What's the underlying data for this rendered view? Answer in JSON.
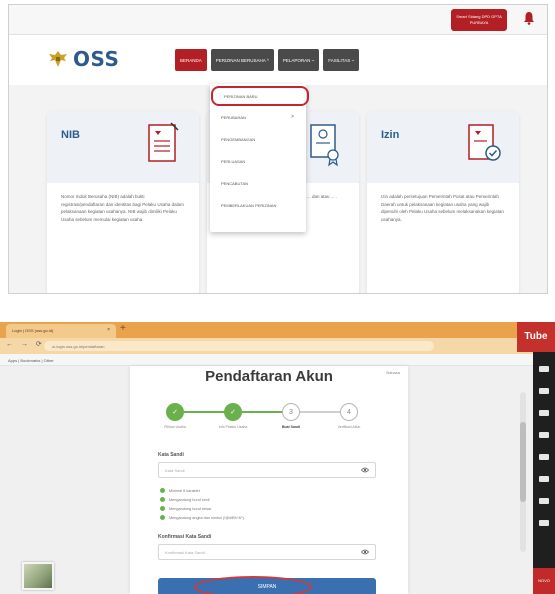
{
  "oss": {
    "user_badge": "Smart Sidang\nDPD GPTA PURBAYA",
    "logo_text": "OSS",
    "nav": [
      "BERANDA",
      "PERIZINAN BERUSAHA ^",
      "PELAPORAN ~",
      "FASILITAS ~"
    ],
    "dropdown": {
      "items": [
        "PERIZINAN BARU",
        "PERUBAHAN",
        "PENGEMBANGAN",
        "PERLUASAN",
        "PENCABUTAN",
        "PEMBERLAKUAN PERIZINAN"
      ],
      "arrow": ">"
    },
    "cards": [
      {
        "title": "NIB",
        "body": "Nomor Induk Berusaha (NIB) adalah bukti registrasi/pendaftaran dan identitas bagi Pelaku Usaha dalam pelaksanaan kegiatan usahanya. NIB wajib dimiliki Pelaku Usaha sebelum memulai kegiatan usaha."
      },
      {
        "title": "",
        "body": "... dan atau ... ."
      },
      {
        "title": "Izin",
        "body": "Izin adalah persetujuan Pemerintah Pusat atau Pemerintah Daerah untuk pelaksanaan kegiatan usaha yang wajib dipenuhi oleh Pelaku Usaha sebelum melaksanakan kegiatan usahanya."
      }
    ]
  },
  "browser": {
    "tab_title": "Login | OSS (oss.go.id)",
    "tab_close": "×",
    "new_tab": "+",
    "nav_arrows": "← → ⟳",
    "address": "ui-login.oss.go.id/pendaftaran",
    "bookmarks": "Apps  |  Bookmarks  |  Other",
    "yt": "Tube",
    "corner": "NOVO"
  },
  "form": {
    "title": "Pendaftaran Akun",
    "lang": "Bahasa",
    "steps": [
      {
        "label": "Pilihan Usaha",
        "state": "done",
        "mark": "✓"
      },
      {
        "label": "Info Pelaku Usaha",
        "state": "done",
        "mark": "✓"
      },
      {
        "label": "Buat Sandi",
        "state": "current",
        "mark": "3"
      },
      {
        "label": "Verifikasi Akun",
        "state": "pending",
        "mark": "4"
      }
    ],
    "password_label": "Kata Sandi",
    "password_placeholder": "Kata Sandi",
    "rules": [
      "Minimal 8 karakter",
      "Mengandung huruf kecil",
      "Mengandung huruf besar",
      "Mengandung angka dan simbol (!@#$%^&*)"
    ],
    "confirm_label": "Konfirmasi Kata Sandi",
    "confirm_placeholder": "Konfirmasi Kata Sandi",
    "submit_label": "SIMPAN"
  }
}
